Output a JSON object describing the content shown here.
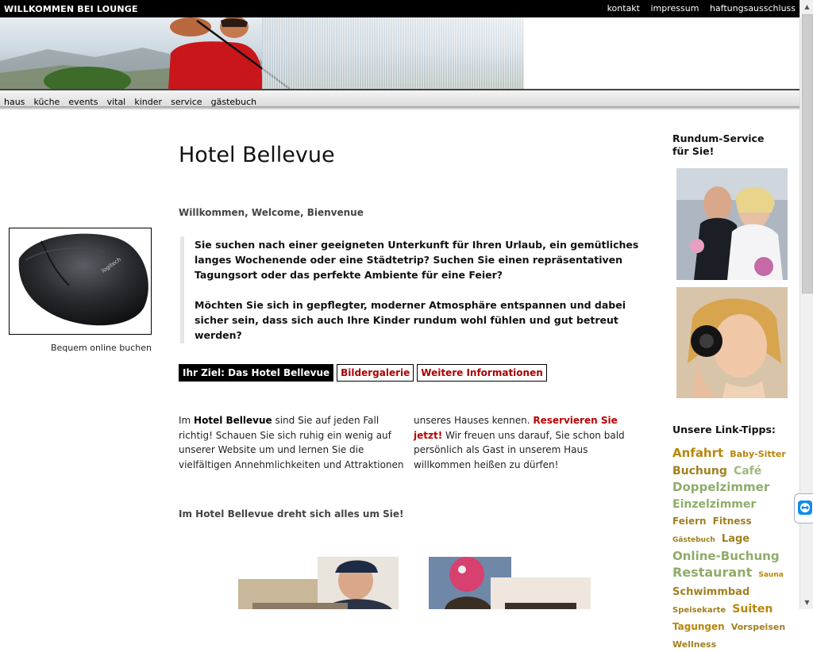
{
  "topbar": {
    "brand": "WILLKOMMEN BEI LOUNGE",
    "links": [
      "kontakt",
      "impressum",
      "haftungsausschluss"
    ]
  },
  "nav": [
    "haus",
    "küche",
    "events",
    "vital",
    "kinder",
    "service",
    "gästebuch"
  ],
  "left": {
    "caption": "Bequem online buchen"
  },
  "main": {
    "title": "Hotel Bellevue",
    "welcome": "Willkommen, Welcome, Bienvenue",
    "quote_p1": "Sie suchen nach einer geeigneten Unterkunft für Ihren Urlaub, ein gemütliches langes Wochenende oder eine Städtetrip? Suchen Sie einen repräsentativen Tagungsort oder das perfekte Ambiente für eine Feier?",
    "quote_p2": "Möchten Sie sich in gepflegter, moderner Atmosphäre entspannen und dabei sicher sein, dass sich auch Ihre Kinder rundum wohl fühlen und gut betreut werden?",
    "buttons": [
      "Ihr Ziel: Das Hotel Bellevue",
      "Bildergalerie",
      "Weitere Informationen"
    ],
    "col1_prefix": "Im ",
    "col1_bold": "Hotel Bellevue",
    "col1_rest": " sind Sie auf jeden Fall richtig! Schauen Sie sich ruhig ein wenig auf unserer Website um und lernen Sie die vielfältigen Annehmlichkeiten und Attraktionen",
    "col2_prefix": "unseres Hauses kennen. ",
    "col2_link": "Reservieren Sie jetzt!",
    "col2_rest": " Wir freuen uns darauf, Sie schon bald persönlich als Gast in unserem Haus willkommen heißen zu dürfen!",
    "around": "Im Hotel Bellevue dreht sich alles um Sie!"
  },
  "right": {
    "service_heading": "Rundum-Service für Sie!",
    "links_heading": "Unsere Link-Tipps:",
    "tags": [
      {
        "label": "Anfahrt",
        "size": 15,
        "color": "#b8860b"
      },
      {
        "label": "Baby-Sitter",
        "size": 11,
        "color": "#b8860b"
      },
      {
        "label": "Buchung",
        "size": 14,
        "color": "#a08020"
      },
      {
        "label": "Café",
        "size": 14,
        "color": "#9fb87a"
      },
      {
        "label": "Doppelzimmer",
        "size": 15,
        "color": "#8fac6a"
      },
      {
        "label": "Einzelzimmer",
        "size": 14,
        "color": "#8fac6a"
      },
      {
        "label": "Feiern",
        "size": 12,
        "color": "#a08020"
      },
      {
        "label": "Fitness",
        "size": 12,
        "color": "#a08020"
      },
      {
        "label": "Gästebuch",
        "size": 9,
        "color": "#a08020"
      },
      {
        "label": "Lage",
        "size": 13,
        "color": "#a08020"
      },
      {
        "label": "Online-Buchung",
        "size": 15,
        "color": "#8fac6a"
      },
      {
        "label": "Restaurant",
        "size": 16,
        "color": "#8fac6a"
      },
      {
        "label": "Sauna",
        "size": 9,
        "color": "#b8860b"
      },
      {
        "label": "Schwimmbad",
        "size": 13,
        "color": "#a08020"
      },
      {
        "label": "Speisekarte",
        "size": 10,
        "color": "#a08020"
      },
      {
        "label": "Suiten",
        "size": 14,
        "color": "#b8860b"
      },
      {
        "label": "Tagungen",
        "size": 12,
        "color": "#b8860b"
      },
      {
        "label": "Vorspeisen",
        "size": 11,
        "color": "#a08020"
      },
      {
        "label": "Wellness",
        "size": 11,
        "color": "#a08020"
      }
    ]
  }
}
